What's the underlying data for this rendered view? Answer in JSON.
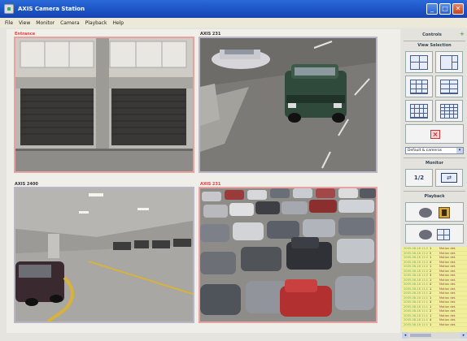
{
  "window": {
    "title": "AXIS Camera Station",
    "buttons": [
      "_",
      "□",
      "✕"
    ]
  },
  "menu": {
    "items": [
      "File",
      "View",
      "Monitor",
      "Camera",
      "Playback",
      "Help"
    ]
  },
  "cameras": [
    {
      "label": "Entrance",
      "alert": true,
      "scene": "garage-doors"
    },
    {
      "label": "AXIS 231",
      "alert": false,
      "scene": "parking-road"
    },
    {
      "label": "AXIS 2400",
      "alert": false,
      "scene": "parking-deck"
    },
    {
      "label": "AXIS 231",
      "alert": true,
      "scene": "parking-lot"
    }
  ],
  "panel": {
    "controls_title": "Controls",
    "view_title": "View Selection",
    "layouts": [
      "1x4",
      "2x2",
      "3x3",
      "3+4",
      "4x4",
      "3+9"
    ],
    "view_select": "Default & cameras",
    "monitor_title": "Monitor",
    "monitor_buttons": [
      "1/2",
      "switch"
    ],
    "playback_title": "Playback"
  },
  "log": {
    "rows": [
      [
        "2005-08-18 11:21:44",
        "1",
        "Motion det."
      ],
      [
        "2005-08-18 11:21:39",
        "2",
        "Motion det."
      ],
      [
        "2005-08-18 11:21:12",
        "1",
        "Motion det."
      ],
      [
        "2005-08-18 11:20:58",
        "4",
        "Motion det."
      ],
      [
        "2005-08-18 11:20:41",
        "1",
        "Motion det."
      ],
      [
        "2005-08-18 11:20:30",
        "2",
        "Motion det."
      ],
      [
        "2005-08-18 11:20:07",
        "3",
        "Motion det."
      ],
      [
        "2005-08-18 11:19:52",
        "1",
        "Motion det."
      ],
      [
        "2005-08-18 11:19:31",
        "4",
        "Motion det."
      ],
      [
        "2005-08-18 11:19:10",
        "1",
        "Motion det."
      ],
      [
        "2005-08-18 11:18:47",
        "2",
        "Motion det."
      ],
      [
        "2005-08-18 11:18:21",
        "1",
        "Motion det."
      ],
      [
        "2005-08-18 11:18:02",
        "3",
        "Motion det."
      ],
      [
        "2005-08-18 11:17:40",
        "1",
        "Motion det."
      ],
      [
        "2005-08-18 11:17:19",
        "2",
        "Motion det."
      ],
      [
        "2005-08-18 11:16:55",
        "1",
        "Motion det."
      ],
      [
        "2005-08-18 11:16:31",
        "4",
        "Motion det."
      ],
      [
        "2005-08-18 11:16:04",
        "1",
        "Motion det."
      ]
    ]
  },
  "colors": {
    "titlebar": "#1b52c4",
    "alert_border": "#e8a2a2",
    "normal_border": "#b9b6c8",
    "log_bg": "#f2ef9a"
  }
}
